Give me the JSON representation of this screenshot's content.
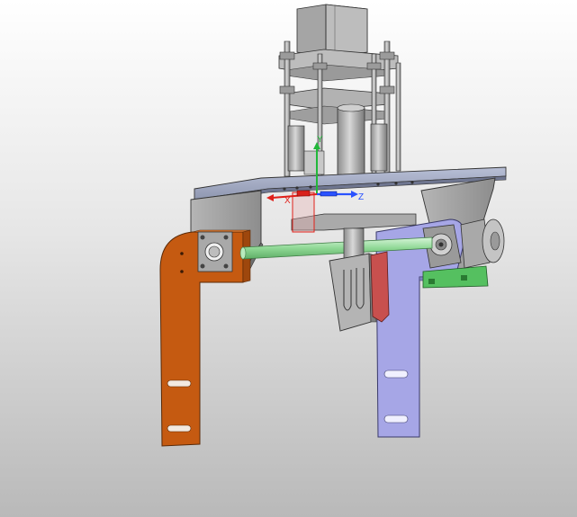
{
  "viewport": {
    "name": "3d-model-viewport",
    "background_top": "#ffffff",
    "background_bottom": "#b9b9b9"
  },
  "triad": {
    "x_label": "X",
    "y_label": "Y",
    "z_label": "Z",
    "x_color": "#e0201a",
    "y_color": "#22b83a",
    "z_color": "#2a52ff"
  },
  "parts": {
    "left_bracket_color": "#c55a11",
    "right_bracket_color": "#a6a6e6",
    "shaft_color": "#9be3a0",
    "mount_color": "#55c060",
    "top_plate_color": "#a9b1c9",
    "metal_color": "#bfbfbf",
    "red_piece_color": "#c8504e",
    "motor_color": "#a9a9a9"
  }
}
